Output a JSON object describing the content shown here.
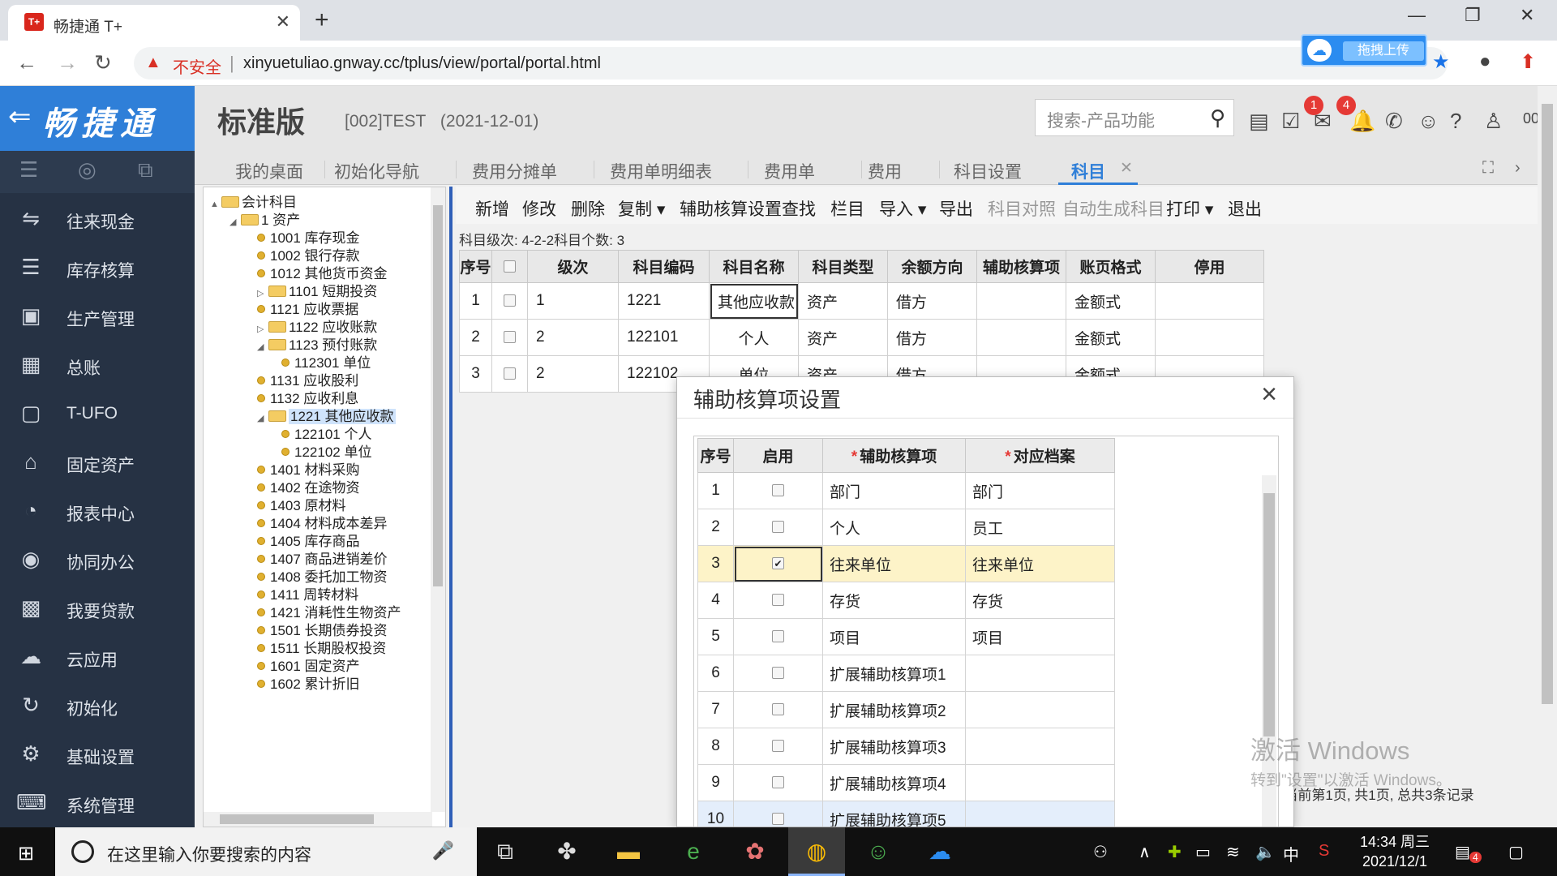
{
  "browser": {
    "tab_title": "畅捷通 T+",
    "favicon_text": "T+",
    "insecure_label": "不安全",
    "url": "xinyuetuliao.gnway.cc/tplus/view/portal/portal.html",
    "upload_label": "拖拽上传"
  },
  "app": {
    "logo_text": "畅捷通",
    "edition": "标准版",
    "account": "[002]TEST",
    "date": "(2021-12-01)",
    "search_placeholder": "搜索-产品功能",
    "badges": [
      "1",
      "4"
    ],
    "user_initials": "00"
  },
  "leftnav": {
    "items": [
      {
        "label": "往来现金",
        "icon": "cash-flow-icon"
      },
      {
        "label": "库存核算",
        "icon": "inventory-icon"
      },
      {
        "label": "生产管理",
        "icon": "production-icon"
      },
      {
        "label": "总账",
        "icon": "ledger-icon"
      },
      {
        "label": "T-UFO",
        "icon": "ufo-icon"
      },
      {
        "label": "固定资产",
        "icon": "fixed-asset-icon"
      },
      {
        "label": "报表中心",
        "icon": "report-icon"
      },
      {
        "label": "协同办公",
        "icon": "collab-icon"
      },
      {
        "label": "我要贷款",
        "icon": "loan-icon"
      },
      {
        "label": "云应用",
        "icon": "cloud-icon"
      },
      {
        "label": "初始化",
        "icon": "init-icon"
      },
      {
        "label": "基础设置",
        "icon": "settings-icon"
      },
      {
        "label": "系统管理",
        "icon": "system-icon"
      }
    ]
  },
  "tabs": [
    {
      "label": "我的桌面"
    },
    {
      "label": "初始化导航"
    },
    {
      "label": "费用分摊单"
    },
    {
      "label": "费用单明细表"
    },
    {
      "label": "费用单"
    },
    {
      "label": "费用"
    },
    {
      "label": "科目设置"
    }
  ],
  "active_tab": "科目",
  "tree": {
    "nodes": [
      {
        "label": "会计科目",
        "type": "folder",
        "toggle": "▲",
        "level": 0
      },
      {
        "label": "1 资产",
        "type": "folder",
        "toggle": "◢",
        "level": 1
      },
      {
        "label": "1001 库存现金",
        "type": "leaf",
        "level": 2
      },
      {
        "label": "1002 银行存款",
        "type": "leaf",
        "level": 2
      },
      {
        "label": "1012 其他货币资金",
        "type": "leaf",
        "level": 2
      },
      {
        "label": "1101 短期投资",
        "type": "folder",
        "toggle": "▷",
        "level": 2
      },
      {
        "label": "1121 应收票据",
        "type": "leaf",
        "level": 2
      },
      {
        "label": "1122 应收账款",
        "type": "folder",
        "toggle": "▷",
        "level": 2
      },
      {
        "label": "1123 预付账款",
        "type": "folder",
        "toggle": "◢",
        "level": 2
      },
      {
        "label": "112301 单位",
        "type": "leaf",
        "level": 3
      },
      {
        "label": "1131 应收股利",
        "type": "leaf",
        "level": 2
      },
      {
        "label": "1132 应收利息",
        "type": "leaf",
        "level": 2
      },
      {
        "label": "1221 其他应收款",
        "type": "folder",
        "toggle": "◢",
        "level": 2,
        "selected": true
      },
      {
        "label": "122101 个人",
        "type": "leaf",
        "level": 3
      },
      {
        "label": "122102 单位",
        "type": "leaf",
        "level": 3
      },
      {
        "label": "1401 材料采购",
        "type": "leaf",
        "level": 2
      },
      {
        "label": "1402 在途物资",
        "type": "leaf",
        "level": 2
      },
      {
        "label": "1403 原材料",
        "type": "leaf",
        "level": 2
      },
      {
        "label": "1404 材料成本差异",
        "type": "leaf",
        "level": 2
      },
      {
        "label": "1405 库存商品",
        "type": "leaf",
        "level": 2
      },
      {
        "label": "1407 商品进销差价",
        "type": "leaf",
        "level": 2
      },
      {
        "label": "1408 委托加工物资",
        "type": "leaf",
        "level": 2
      },
      {
        "label": "1411 周转材料",
        "type": "leaf",
        "level": 2
      },
      {
        "label": "1421 消耗性生物资产",
        "type": "leaf",
        "level": 2
      },
      {
        "label": "1501 长期债券投资",
        "type": "leaf",
        "level": 2
      },
      {
        "label": "1511 长期股权投资",
        "type": "leaf",
        "level": 2
      },
      {
        "label": "1601 固定资产",
        "type": "leaf",
        "level": 2
      },
      {
        "label": "1602 累计折旧",
        "type": "leaf",
        "level": 2
      }
    ]
  },
  "toolbar": {
    "items": [
      {
        "label": "新增",
        "enabled": true
      },
      {
        "label": "修改",
        "enabled": true
      },
      {
        "label": "删除",
        "enabled": true
      },
      {
        "label": "复制 ▾",
        "enabled": true
      },
      {
        "label": "辅助核算设置",
        "enabled": true
      },
      {
        "label": "查找",
        "enabled": true
      },
      {
        "label": "栏目",
        "enabled": true
      },
      {
        "label": "导入 ▾",
        "enabled": true
      },
      {
        "label": "导出",
        "enabled": true
      },
      {
        "label": "科目对照",
        "enabled": false
      },
      {
        "label": "自动生成科目",
        "enabled": false
      },
      {
        "label": "打印 ▾",
        "enabled": true
      },
      {
        "label": "退出",
        "enabled": true
      }
    ]
  },
  "level_info": "科目级次:   4-2-2科目个数:   3",
  "grid": {
    "headers": [
      "序号",
      "",
      "级次",
      "科目编码",
      "科目名称",
      "科目类型",
      "余额方向",
      "辅助核算项",
      "账页格式",
      "停用"
    ],
    "rows": [
      {
        "no": "1",
        "level": "1",
        "code": "1221",
        "name": "其他应收款",
        "type": "资产",
        "direction": "借方",
        "aux": "",
        "format": "金额式",
        "disabled": ""
      },
      {
        "no": "2",
        "level": "2",
        "code": "122101",
        "name": "个人",
        "type": "资产",
        "direction": "借方",
        "aux": "",
        "format": "金额式",
        "disabled": ""
      },
      {
        "no": "3",
        "level": "2",
        "code": "122102",
        "name": "单位",
        "type": "资产",
        "direction": "借方",
        "aux": "",
        "format": "金额式",
        "disabled": ""
      }
    ]
  },
  "pager_text": "⇥| 当前第1页, 共1页, 总共3条记录",
  "dialog": {
    "title": "辅助核算项设置",
    "headers": {
      "no": "序号",
      "enabled": "启用",
      "item": "辅助核算项",
      "archive": "对应档案"
    },
    "required_mark": "*",
    "rows": [
      {
        "no": "1",
        "checked": false,
        "item": "部门",
        "archive": "部门"
      },
      {
        "no": "2",
        "checked": false,
        "item": "个人",
        "archive": "员工"
      },
      {
        "no": "3",
        "checked": true,
        "item": "往来单位",
        "archive": "往来单位"
      },
      {
        "no": "4",
        "checked": false,
        "item": "存货",
        "archive": "存货"
      },
      {
        "no": "5",
        "checked": false,
        "item": "项目",
        "archive": "项目"
      },
      {
        "no": "6",
        "checked": false,
        "item": "扩展辅助核算项1",
        "archive": ""
      },
      {
        "no": "7",
        "checked": false,
        "item": "扩展辅助核算项2",
        "archive": ""
      },
      {
        "no": "8",
        "checked": false,
        "item": "扩展辅助核算项3",
        "archive": ""
      },
      {
        "no": "9",
        "checked": false,
        "item": "扩展辅助核算项4",
        "archive": ""
      },
      {
        "no": "10",
        "checked": false,
        "item": "扩展辅助核算项5",
        "archive": ""
      }
    ]
  },
  "activation": {
    "line1": "激活 Windows",
    "line2": "转到\"设置\"以激活 Windows。"
  },
  "taskbar": {
    "search_placeholder": "在这里输入你要搜索的内容",
    "ime": "中",
    "time": "14:34 周三",
    "date": "2021/12/1",
    "notif_count": "4"
  },
  "colors": {
    "brand_blue": "#2f7fd8",
    "nav_bg": "#263244",
    "highlight_row": "#fdf3c8",
    "badge_red": "#e53935"
  }
}
